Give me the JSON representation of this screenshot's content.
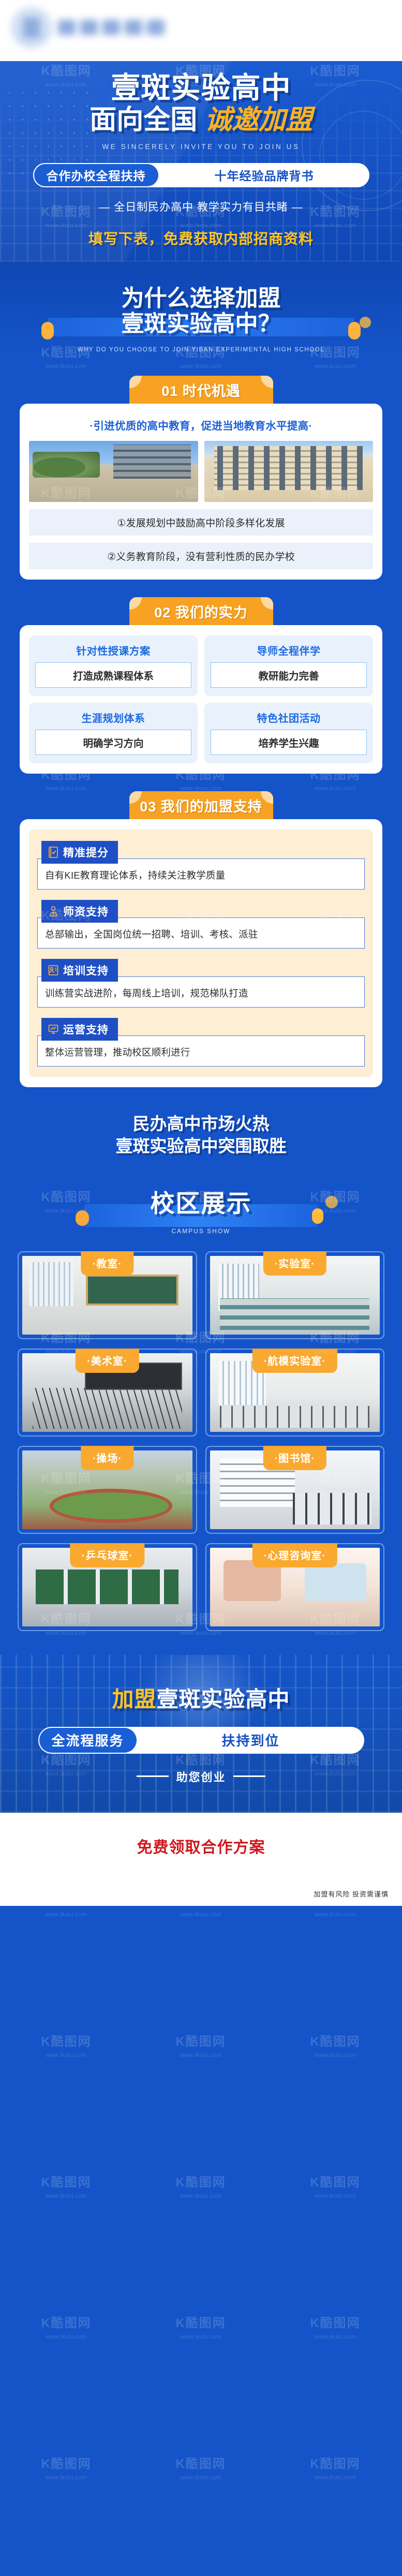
{
  "colors": {
    "brand_blue": "#1554c8",
    "accent_gold": "#f7a222",
    "accent_yellow": "#ffc425",
    "cta_red": "#d0161b",
    "card_white": "#ffffff",
    "cream": "#fdeed4"
  },
  "watermark": {
    "mark": "K酷图网",
    "domain": "www.ikutu.com"
  },
  "logo": {
    "alt": "school-logo"
  },
  "hero": {
    "title_line1": "壹斑实验高中",
    "title_line2_white": "面向全国",
    "title_line2_gold": "诚邀加盟",
    "english": "WE SINCERELY INVITE YOU TO JOIN US",
    "pill_left": "合作办校全程扶持",
    "pill_right": "十年经验品牌背书",
    "subline": "— 全日制民办高中 教学实力有目共睹 —",
    "cta": "填写下表，免费获取内部招商资料"
  },
  "why": {
    "line1": "为什么选择加盟",
    "line2": "壹斑实验高中？",
    "english": "WHY DO YOU CHOOSE TO JOIN YIBAN EXPERIMENTAL HIGH SCHOOL"
  },
  "section01": {
    "head": "01 时代机遇",
    "lead": "·引进优质的高中教育，促进当地教育水平提高·",
    "photos": [
      {
        "name": "campus-courtyard-photo"
      },
      {
        "name": "school-building-photo"
      }
    ],
    "points": [
      "①发展规划中鼓励高中阶段多样化发展",
      "②义务教育阶段，没有营利性质的民办学校"
    ]
  },
  "section02": {
    "head": "02 我们的实力",
    "cards": [
      {
        "title": "针对性授课方案",
        "body": "打造成熟课程体系"
      },
      {
        "title": "导师全程伴学",
        "body": "教研能力完善"
      },
      {
        "title": "生涯规划体系",
        "body": "明确学习方向"
      },
      {
        "title": "特色社团活动",
        "body": "培养学生兴趣"
      }
    ]
  },
  "section03": {
    "head": "03 我们的加盟支持",
    "items": [
      {
        "icon": "checked-book-icon",
        "title": "精准提分",
        "body": "自有KIE教育理论体系，持续关注教学质量"
      },
      {
        "icon": "person-badge-icon",
        "title": "师资支持",
        "body": "总部输出，全国岗位统一招聘、培训、考核、派驻"
      },
      {
        "icon": "training-board-icon",
        "title": "培训支持",
        "body": "训练营实战进阶，每周线上培训，规范梯队打造"
      },
      {
        "icon": "monitor-chart-icon",
        "title": "运营支持",
        "body": "整体运营管理，推动校区顺利进行"
      }
    ]
  },
  "mid_banner": {
    "line1": "民办高中市场火热",
    "line2": "壹斑实验高中突围取胜"
  },
  "campus_show": {
    "title": "校区展示",
    "english": "CAMPUS SHOW",
    "rooms": [
      {
        "label": "·教室·",
        "photo": "classroom-photo"
      },
      {
        "label": "·实验室·",
        "photo": "laboratory-photo"
      },
      {
        "label": "·美术室·",
        "photo": "art-room-photo"
      },
      {
        "label": "·航模实验室·",
        "photo": "aeromodelling-lab-photo"
      },
      {
        "label": "·操场·",
        "photo": "sports-field-photo"
      },
      {
        "label": "·图书馆·",
        "photo": "library-photo"
      },
      {
        "label": "·乒乓球室·",
        "photo": "table-tennis-room-photo"
      },
      {
        "label": "·心理咨询室·",
        "photo": "counseling-room-photo"
      }
    ]
  },
  "footer_hero": {
    "title_gold": "加盟",
    "title_white": "壹斑实验高中",
    "pill_left": "全流程服务",
    "pill_right": "扶持到位",
    "sub": "助您创业"
  },
  "bottom": {
    "cta": "免费领取合作方案",
    "disclaimer": "加盟有风险 投资需谨慎"
  }
}
